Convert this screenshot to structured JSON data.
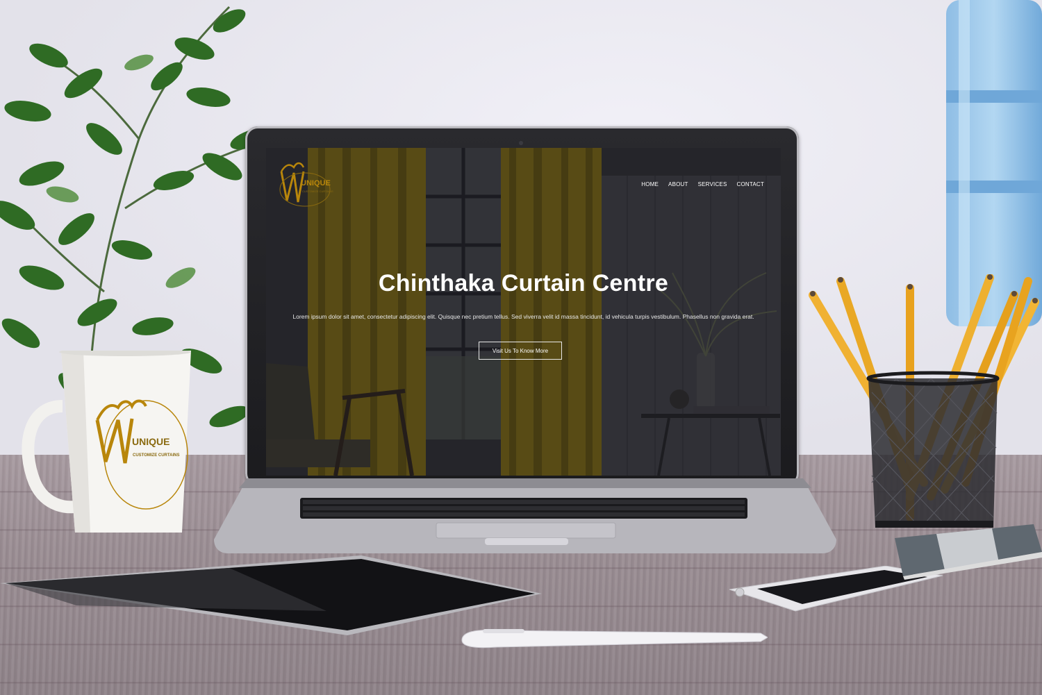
{
  "mug": {
    "brand_name": "UNIQUE",
    "brand_tagline": "CUSTOMIZE CURTAINS"
  },
  "website": {
    "logo": {
      "name": "UNIQUE",
      "tagline": "CUSTOMIZE CURTAINS"
    },
    "nav": {
      "items": [
        {
          "label": "HOME"
        },
        {
          "label": "ABOUT"
        },
        {
          "label": "SERVICES"
        },
        {
          "label": "CONTACT"
        }
      ]
    },
    "hero": {
      "title": "Chinthaka Curtain Centre",
      "text": "Lorem ipsum dolor sit amet, consectetur adipiscing elit. Quisque nec pretium tellus. Sed viverra velit id massa tincidunt, id vehicula turpis vestibulum. Phasellus non gravida erat.",
      "button_label": "Visit Us To Know More"
    }
  },
  "colors": {
    "brand_gold": "#b8860b",
    "curtain_yellow": "#a68a12",
    "hero_overlay": "#2b2a30",
    "text_white": "#ffffff"
  },
  "icons": [
    "curtain-logo-icon",
    "plant-decoration",
    "water-bottle",
    "pencil-cup",
    "tablet-device",
    "phone-device",
    "pen-item"
  ]
}
